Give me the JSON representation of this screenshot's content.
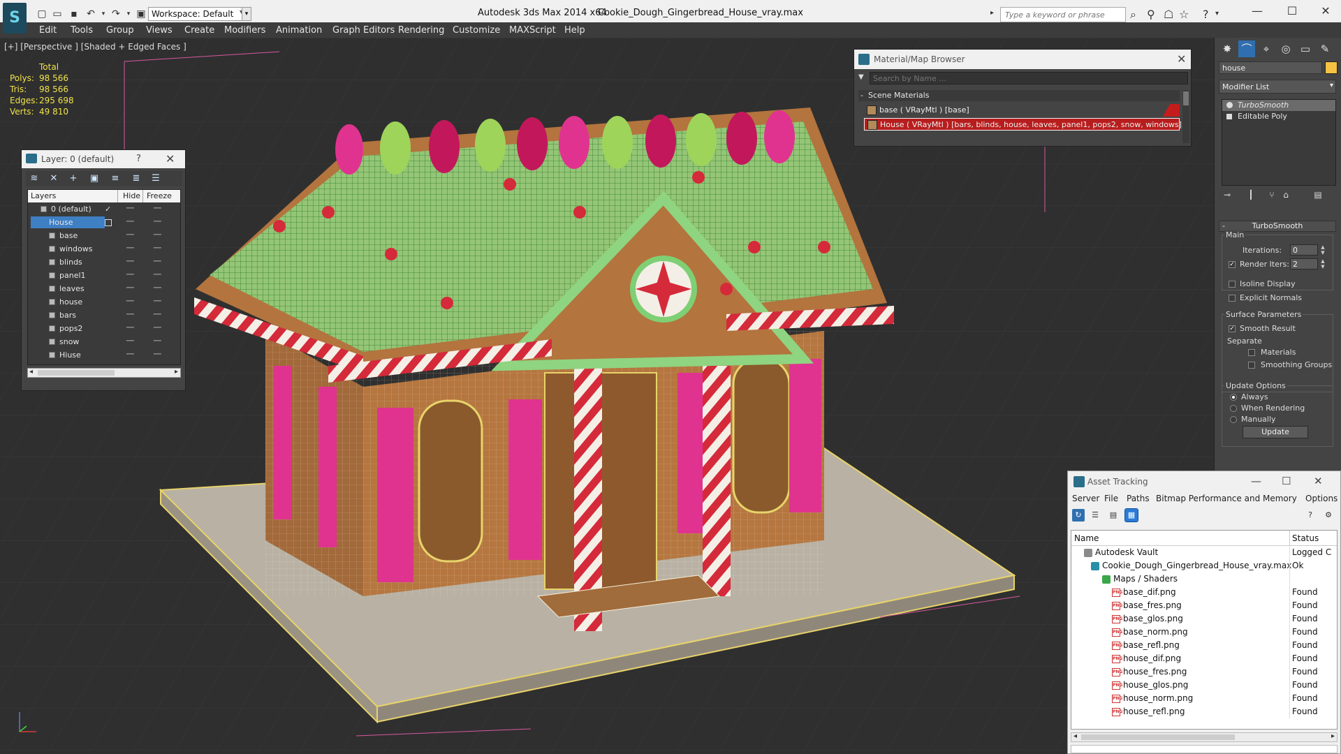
{
  "titlebar": {
    "workspace": "Workspace: Default",
    "app_title": "Autodesk 3ds Max  2014 x64",
    "file_title": "Cookie_Dough_Gingerbread_House_vray.max",
    "search_placeholder": "Type a keyword or phrase"
  },
  "menu": [
    "Edit",
    "Tools",
    "Group",
    "Views",
    "Create",
    "Modifiers",
    "Animation",
    "Graph Editors",
    "Rendering",
    "Customize",
    "MAXScript",
    "Help"
  ],
  "viewport": {
    "label": "[+] [Perspective ] [Shaded + Edged Faces ]",
    "stats": {
      "total": "Total",
      "polys_label": "Polys:",
      "polys": "98 566",
      "tris_label": "Tris:",
      "tris": "98 566",
      "edges_label": "Edges:",
      "edges": "295 698",
      "verts_label": "Verts:",
      "verts": "49 810"
    }
  },
  "layer_panel": {
    "title": "Layer: 0 (default)",
    "help": "?",
    "col_layers": "Layers",
    "col_hide": "Hide",
    "col_freeze": "Freeze",
    "rows": [
      {
        "name": "0 (default)"
      },
      {
        "name": "House"
      },
      {
        "name": "base"
      },
      {
        "name": "windows"
      },
      {
        "name": "blinds"
      },
      {
        "name": "panel1"
      },
      {
        "name": "leaves"
      },
      {
        "name": "house"
      },
      {
        "name": "bars"
      },
      {
        "name": "pops2"
      },
      {
        "name": "snow"
      },
      {
        "name": "Hiuse"
      }
    ]
  },
  "material_browser": {
    "title": "Material/Map Browser",
    "search_placeholder": "Search by Name ...",
    "section": "Scene Materials",
    "items": [
      {
        "label": "base  ( VRayMtl ) [base]"
      },
      {
        "label": "House  ( VRayMtl ) [bars, blinds, house, leaves, panel1, pops2, snow, windows]"
      }
    ]
  },
  "command_panel": {
    "object_name": "house",
    "object_color": "#f5c242",
    "modifier_list": "Modifier List",
    "stack": [
      "TurboSmooth",
      "Editable Poly"
    ],
    "rollout_title": "TurboSmooth",
    "main_label": "Main",
    "iterations_label": "Iterations:",
    "iterations": "0",
    "render_iters_label": "Render Iters:",
    "render_iters": "2",
    "isoline": "Isoline Display",
    "explicit_normals": "Explicit Normals",
    "surface_params": "Surface Parameters",
    "smooth_result": "Smooth Result",
    "separate": "Separate",
    "materials": "Materials",
    "smoothing_groups": "Smoothing Groups",
    "update_options": "Update Options",
    "always": "Always",
    "when_rendering": "When Rendering",
    "manually": "Manually",
    "update_button": "Update"
  },
  "asset_tracking": {
    "title": "Asset Tracking",
    "menu": [
      "Server",
      "File",
      "Paths",
      "Bitmap Performance and Memory",
      "Options"
    ],
    "col_name": "Name",
    "col_status": "Status",
    "rows": [
      {
        "name": "Autodesk Vault",
        "status": "Logged C",
        "icon": "vault",
        "indent": 1
      },
      {
        "name": "Cookie_Dough_Gingerbread_House_vray.max",
        "status": "Ok",
        "icon": "max",
        "indent": 2
      },
      {
        "name": "Maps / Shaders",
        "status": "",
        "icon": "maps",
        "indent": 3
      },
      {
        "name": "base_dif.png",
        "status": "Found",
        "icon": "png",
        "indent": 4
      },
      {
        "name": "base_fres.png",
        "status": "Found",
        "icon": "png",
        "indent": 4
      },
      {
        "name": "base_glos.png",
        "status": "Found",
        "icon": "png",
        "indent": 4
      },
      {
        "name": "base_norm.png",
        "status": "Found",
        "icon": "png",
        "indent": 4
      },
      {
        "name": "base_refl.png",
        "status": "Found",
        "icon": "png",
        "indent": 4
      },
      {
        "name": "house_dif.png",
        "status": "Found",
        "icon": "png",
        "indent": 4
      },
      {
        "name": "house_fres.png",
        "status": "Found",
        "icon": "png",
        "indent": 4
      },
      {
        "name": "house_glos.png",
        "status": "Found",
        "icon": "png",
        "indent": 4
      },
      {
        "name": "house_norm.png",
        "status": "Found",
        "icon": "png",
        "indent": 4
      },
      {
        "name": "house_refl.png",
        "status": "Found",
        "icon": "png",
        "indent": 4
      }
    ]
  }
}
